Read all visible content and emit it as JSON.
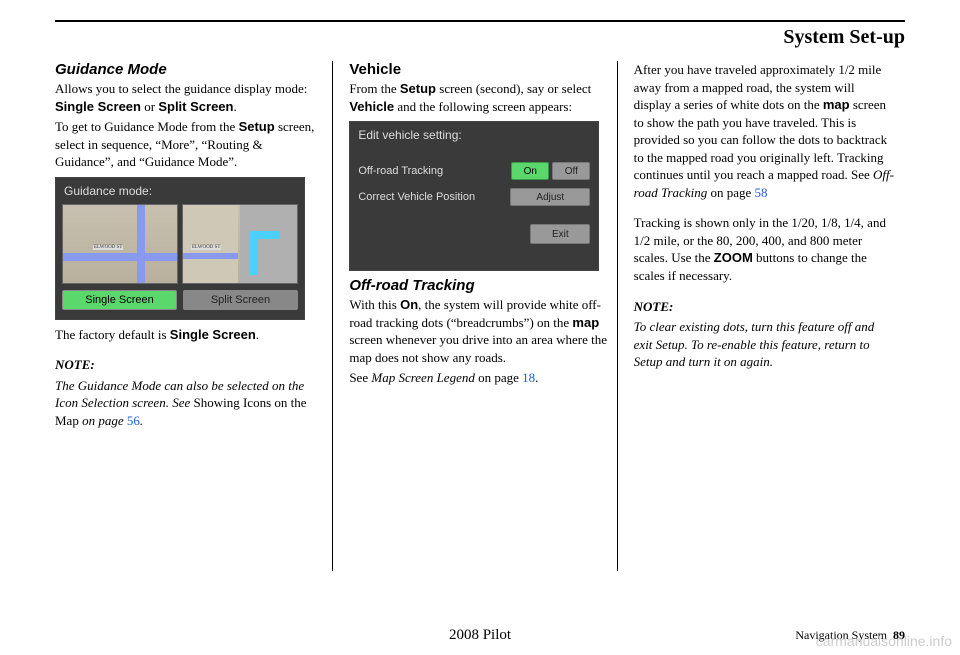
{
  "header": {
    "title": "System Set-up"
  },
  "col1": {
    "h_guidance": "Guidance Mode",
    "p1a": "Allows you to select the guidance display mode: ",
    "p1b": "Single Screen",
    "p1c": " or ",
    "p1d": "Split Screen",
    "p1e": ".",
    "p2a": "To get to Guidance Mode from the ",
    "p2b": "Setup",
    "p2c": " screen, select in sequence, “More”, “Routing & Guidance”, and “Guidance Mode”.",
    "shot_title": "Guidance mode:",
    "btn_single": "Single Screen",
    "btn_split": "Split Screen",
    "p3a": "The factory default is ",
    "p3b": "Single Screen",
    "p3c": ".",
    "note_label": "NOTE:",
    "note1a": "The Guidance Mode can also be selected on the Icon Selection screen. See ",
    "note1b": "Showing Icons on the Map",
    "note1c": " on page ",
    "note1d": "56",
    "note1e": "."
  },
  "col2": {
    "h_vehicle": "Vehicle",
    "p1a": "From the ",
    "p1b": "Setup",
    "p1c": " screen (second), say or select ",
    "p1d": "Vehicle",
    "p1e": " and the following screen appears:",
    "shot_title": "Edit vehicle setting:",
    "field1": "Off-road Tracking",
    "on": "On",
    "off": "Off",
    "field2": "Correct Vehicle Position",
    "adjust": "Adjust",
    "exit": "Exit",
    "h_offroad": "Off-road Tracking",
    "p2a": "With this ",
    "p2b": "On",
    "p2c": ", the system will provide white off-road tracking dots (“breadcrumbs”) on the ",
    "p2d": "map",
    "p2e": " screen whenever you drive into an area where the map does not show any roads.",
    "p3a": "See ",
    "p3b": "Map Screen Legend",
    "p3c": " on page ",
    "p3d": "18",
    "p3e": "."
  },
  "col3": {
    "p1a": "After you have traveled approximately 1/2 mile away from a mapped road, the system will display a series of white dots on the ",
    "p1b": "map",
    "p1c": " screen to show the path you have traveled. This is provided so you can follow the dots to backtrack to the mapped road you originally left. Tracking continues until you reach a mapped road. See ",
    "p1d": "Off-road Tracking",
    "p1e": " on page ",
    "p1f": "58",
    "p2a": "Tracking is shown only in the 1/20, 1/8, 1/4, and 1/2 mile, or the 80, 200, 400, and 800 meter scales. Use the ",
    "p2b": "ZOOM",
    "p2c": " buttons to change the scales if necessary.",
    "note_label": "NOTE:",
    "note1": "To clear existing dots, turn this feature off and exit Setup. To re-enable this feature, return to Setup and turn it on again."
  },
  "footer": {
    "center": "2008  Pilot",
    "right_label": "Navigation System",
    "page": "89"
  },
  "watermark": "carmanualsonline.info"
}
